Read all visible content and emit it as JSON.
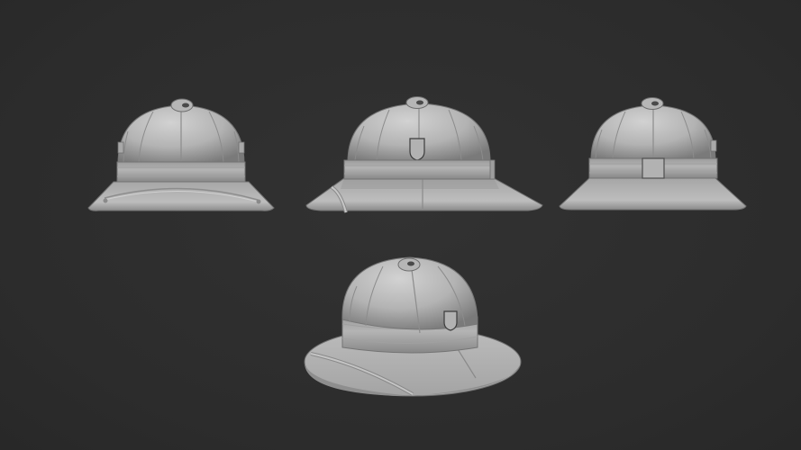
{
  "scene": {
    "background_color": "#2d2d2d",
    "material_color": "#b4b4b4",
    "subject": "pith-helmet-sculpt",
    "views": [
      {
        "id": "view-left-side",
        "icon": "pith-helmet-icon"
      },
      {
        "id": "view-front",
        "icon": "pith-helmet-icon"
      },
      {
        "id": "view-right-side",
        "icon": "pith-helmet-icon"
      },
      {
        "id": "view-three-quarter",
        "icon": "pith-helmet-icon"
      }
    ]
  }
}
